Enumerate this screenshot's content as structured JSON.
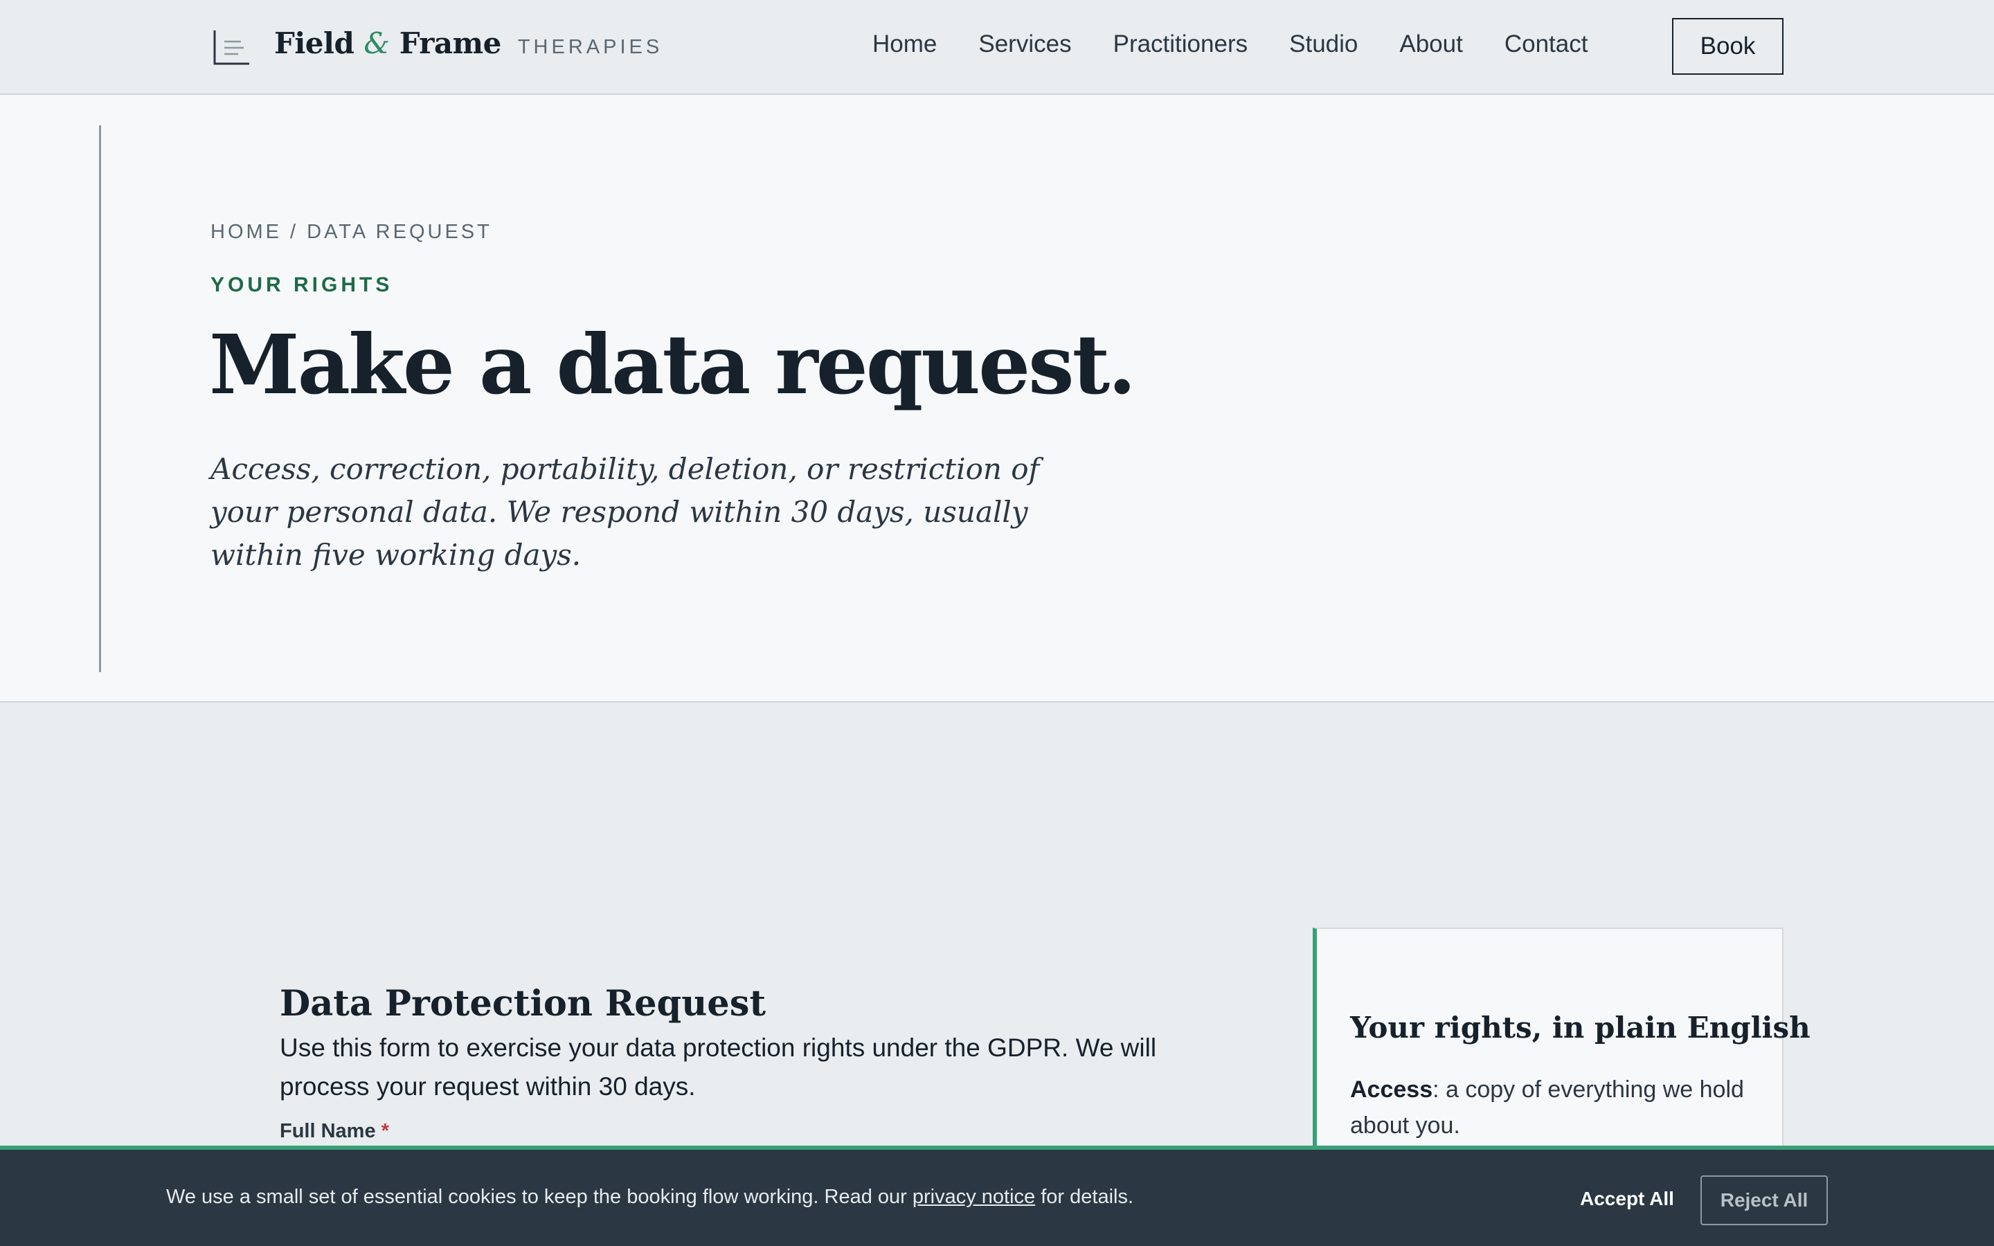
{
  "header": {
    "brand_name_left": "Field",
    "brand_amp": "&",
    "brand_name_right": "Frame",
    "brand_sub": "THERAPIES",
    "logo_icon": "menu-lines-icon",
    "nav": [
      "Home",
      "Services",
      "Practitioners",
      "Studio",
      "About",
      "Contact"
    ],
    "book_label": "Book"
  },
  "hero": {
    "breadcrumb": "HOME / DATA REQUEST",
    "kicker": "YOUR RIGHTS",
    "title": "Make a data request.",
    "lede": "Access, correction, portability, deletion, or restriction of your personal data. We respond within 30 days, usually within five working days."
  },
  "form": {
    "title": "Data Protection Request",
    "description": "Use this form to exercise your data protection rights under the GDPR. We will process your request within 30 days.",
    "full_name_label": "Full Name",
    "required_marker": "*"
  },
  "aside": {
    "title": "Your rights, in plain English",
    "access_term": "Access",
    "access_text": ": a copy of everything we hold about you."
  },
  "cookie": {
    "text_before": "We use a small set of essential cookies to keep the booking flow working. Read our ",
    "link": "privacy notice",
    "text_after": " for details.",
    "accept": "Accept All",
    "reject": "Reject All"
  },
  "colors": {
    "accent_green": "#2e8a61",
    "ink": "#16212b",
    "cookie_bg": "#2b3742",
    "required_red": "#c43a3a"
  }
}
